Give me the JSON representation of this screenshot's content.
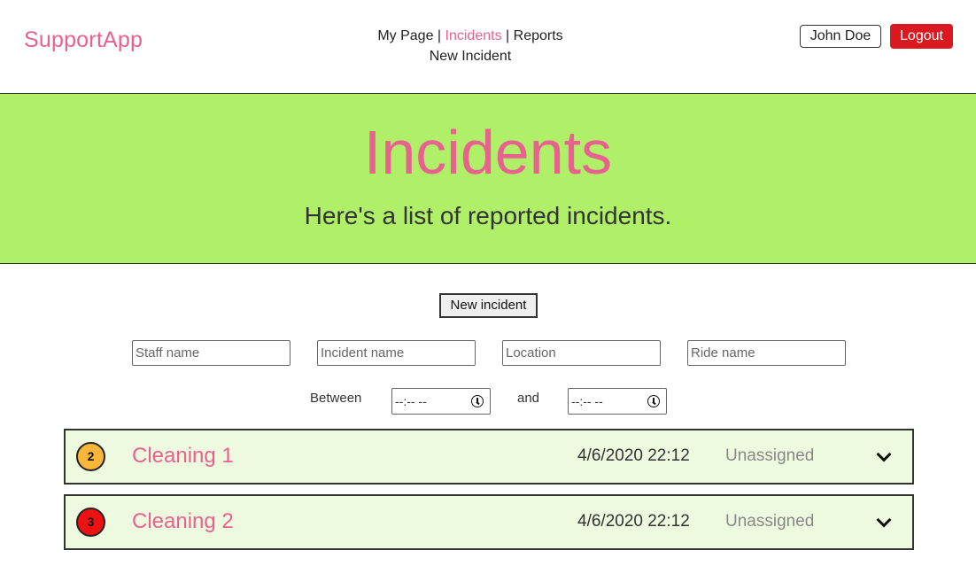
{
  "app": {
    "brand": "SupportApp"
  },
  "nav": {
    "my_page": "My Page",
    "incidents": "Incidents",
    "reports": "Reports",
    "separator": "|",
    "new_incident": "New Incident"
  },
  "user": {
    "name": "John Doe",
    "logout_label": "Logout"
  },
  "hero": {
    "title": "Incidents",
    "subtitle": "Here's a list of reported incidents."
  },
  "actions": {
    "new_incident_button": "New incident"
  },
  "filters": {
    "staff_placeholder": "Staff name",
    "incident_placeholder": "Incident name",
    "location_placeholder": "Location",
    "ride_placeholder": "Ride name",
    "between_label": "Between",
    "and_label": "and",
    "from_time_value": "--:-- --",
    "to_time_value": "--:-- --"
  },
  "incidents": [
    {
      "priority": "2",
      "priority_color": "#f9b73a",
      "name": "Cleaning 1",
      "datetime": "4/6/2020 22:12",
      "status": "Unassigned"
    },
    {
      "priority": "3",
      "priority_color": "#ee1111",
      "name": "Cleaning 2",
      "datetime": "4/6/2020 22:12",
      "status": "Unassigned"
    }
  ],
  "colors": {
    "accent_pink": "#e8628f",
    "hero_green": "#b0ef68",
    "row_green": "#eefadf",
    "logout_red": "#d9191f"
  }
}
